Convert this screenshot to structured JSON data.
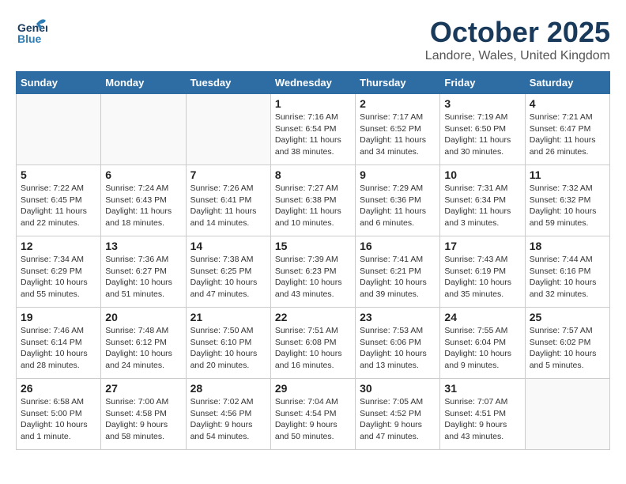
{
  "header": {
    "logo_general": "General",
    "logo_blue": "Blue",
    "month": "October 2025",
    "location": "Landore, Wales, United Kingdom"
  },
  "weekdays": [
    "Sunday",
    "Monday",
    "Tuesday",
    "Wednesday",
    "Thursday",
    "Friday",
    "Saturday"
  ],
  "weeks": [
    [
      {
        "day": "",
        "info": ""
      },
      {
        "day": "",
        "info": ""
      },
      {
        "day": "",
        "info": ""
      },
      {
        "day": "1",
        "info": "Sunrise: 7:16 AM\nSunset: 6:54 PM\nDaylight: 11 hours\nand 38 minutes."
      },
      {
        "day": "2",
        "info": "Sunrise: 7:17 AM\nSunset: 6:52 PM\nDaylight: 11 hours\nand 34 minutes."
      },
      {
        "day": "3",
        "info": "Sunrise: 7:19 AM\nSunset: 6:50 PM\nDaylight: 11 hours\nand 30 minutes."
      },
      {
        "day": "4",
        "info": "Sunrise: 7:21 AM\nSunset: 6:47 PM\nDaylight: 11 hours\nand 26 minutes."
      }
    ],
    [
      {
        "day": "5",
        "info": "Sunrise: 7:22 AM\nSunset: 6:45 PM\nDaylight: 11 hours\nand 22 minutes."
      },
      {
        "day": "6",
        "info": "Sunrise: 7:24 AM\nSunset: 6:43 PM\nDaylight: 11 hours\nand 18 minutes."
      },
      {
        "day": "7",
        "info": "Sunrise: 7:26 AM\nSunset: 6:41 PM\nDaylight: 11 hours\nand 14 minutes."
      },
      {
        "day": "8",
        "info": "Sunrise: 7:27 AM\nSunset: 6:38 PM\nDaylight: 11 hours\nand 10 minutes."
      },
      {
        "day": "9",
        "info": "Sunrise: 7:29 AM\nSunset: 6:36 PM\nDaylight: 11 hours\nand 6 minutes."
      },
      {
        "day": "10",
        "info": "Sunrise: 7:31 AM\nSunset: 6:34 PM\nDaylight: 11 hours\nand 3 minutes."
      },
      {
        "day": "11",
        "info": "Sunrise: 7:32 AM\nSunset: 6:32 PM\nDaylight: 10 hours\nand 59 minutes."
      }
    ],
    [
      {
        "day": "12",
        "info": "Sunrise: 7:34 AM\nSunset: 6:29 PM\nDaylight: 10 hours\nand 55 minutes."
      },
      {
        "day": "13",
        "info": "Sunrise: 7:36 AM\nSunset: 6:27 PM\nDaylight: 10 hours\nand 51 minutes."
      },
      {
        "day": "14",
        "info": "Sunrise: 7:38 AM\nSunset: 6:25 PM\nDaylight: 10 hours\nand 47 minutes."
      },
      {
        "day": "15",
        "info": "Sunrise: 7:39 AM\nSunset: 6:23 PM\nDaylight: 10 hours\nand 43 minutes."
      },
      {
        "day": "16",
        "info": "Sunrise: 7:41 AM\nSunset: 6:21 PM\nDaylight: 10 hours\nand 39 minutes."
      },
      {
        "day": "17",
        "info": "Sunrise: 7:43 AM\nSunset: 6:19 PM\nDaylight: 10 hours\nand 35 minutes."
      },
      {
        "day": "18",
        "info": "Sunrise: 7:44 AM\nSunset: 6:16 PM\nDaylight: 10 hours\nand 32 minutes."
      }
    ],
    [
      {
        "day": "19",
        "info": "Sunrise: 7:46 AM\nSunset: 6:14 PM\nDaylight: 10 hours\nand 28 minutes."
      },
      {
        "day": "20",
        "info": "Sunrise: 7:48 AM\nSunset: 6:12 PM\nDaylight: 10 hours\nand 24 minutes."
      },
      {
        "day": "21",
        "info": "Sunrise: 7:50 AM\nSunset: 6:10 PM\nDaylight: 10 hours\nand 20 minutes."
      },
      {
        "day": "22",
        "info": "Sunrise: 7:51 AM\nSunset: 6:08 PM\nDaylight: 10 hours\nand 16 minutes."
      },
      {
        "day": "23",
        "info": "Sunrise: 7:53 AM\nSunset: 6:06 PM\nDaylight: 10 hours\nand 13 minutes."
      },
      {
        "day": "24",
        "info": "Sunrise: 7:55 AM\nSunset: 6:04 PM\nDaylight: 10 hours\nand 9 minutes."
      },
      {
        "day": "25",
        "info": "Sunrise: 7:57 AM\nSunset: 6:02 PM\nDaylight: 10 hours\nand 5 minutes."
      }
    ],
    [
      {
        "day": "26",
        "info": "Sunrise: 6:58 AM\nSunset: 5:00 PM\nDaylight: 10 hours\nand 1 minute."
      },
      {
        "day": "27",
        "info": "Sunrise: 7:00 AM\nSunset: 4:58 PM\nDaylight: 9 hours\nand 58 minutes."
      },
      {
        "day": "28",
        "info": "Sunrise: 7:02 AM\nSunset: 4:56 PM\nDaylight: 9 hours\nand 54 minutes."
      },
      {
        "day": "29",
        "info": "Sunrise: 7:04 AM\nSunset: 4:54 PM\nDaylight: 9 hours\nand 50 minutes."
      },
      {
        "day": "30",
        "info": "Sunrise: 7:05 AM\nSunset: 4:52 PM\nDaylight: 9 hours\nand 47 minutes."
      },
      {
        "day": "31",
        "info": "Sunrise: 7:07 AM\nSunset: 4:51 PM\nDaylight: 9 hours\nand 43 minutes."
      },
      {
        "day": "",
        "info": ""
      }
    ]
  ]
}
